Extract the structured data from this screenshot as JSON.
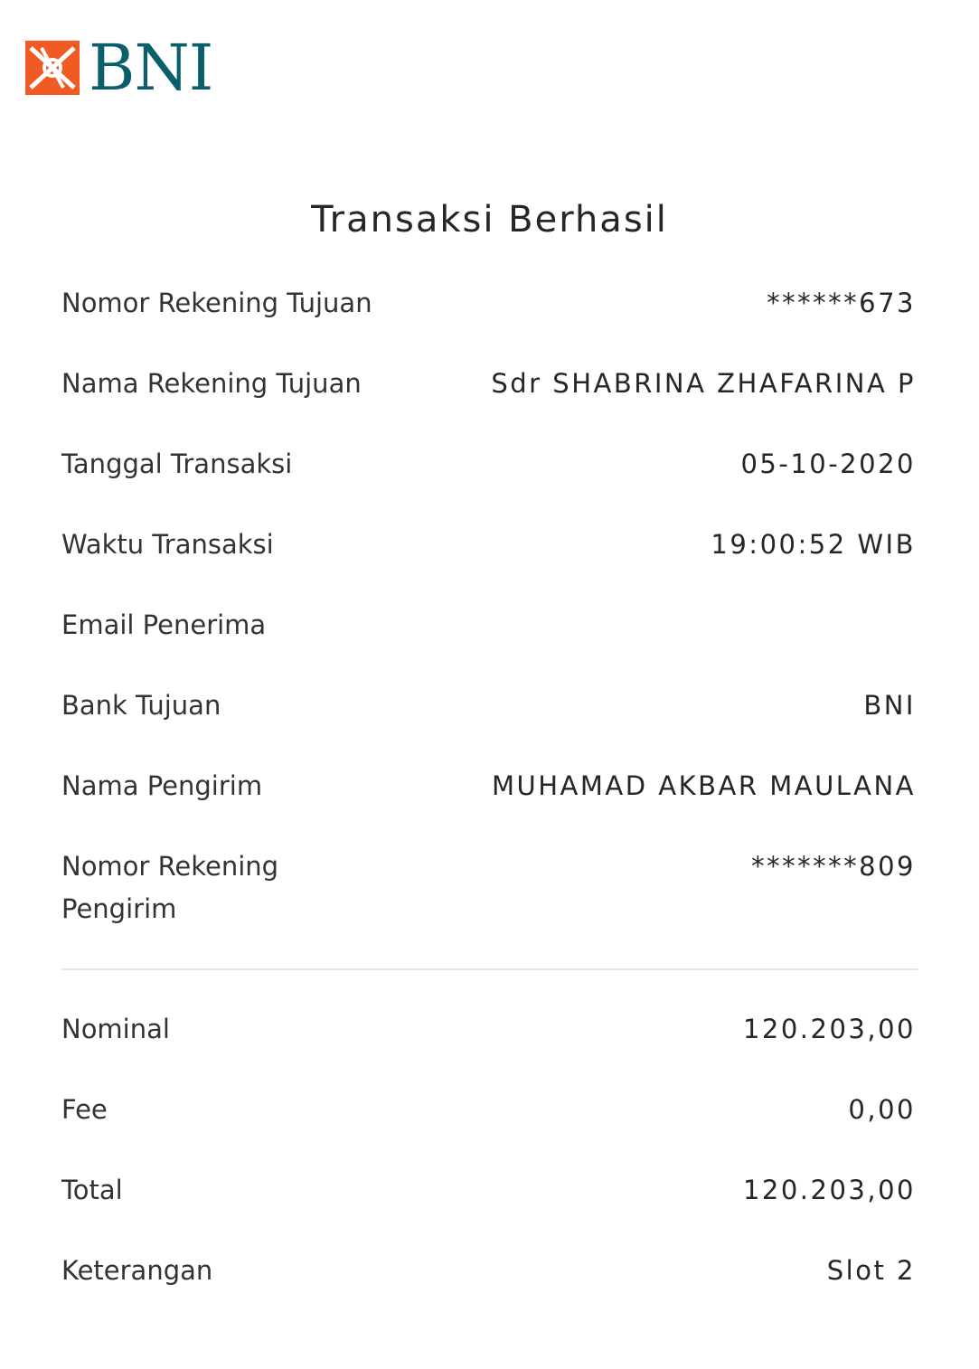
{
  "logo": {
    "brand_text": "BNI",
    "colors": {
      "mark": "#f15a23",
      "text": "#0b5f6b"
    }
  },
  "title": "Transaksi Berhasil",
  "details": [
    {
      "label": "Nomor Rekening Tujuan",
      "value": "******673"
    },
    {
      "label": "Nama Rekening Tujuan",
      "value": "Sdr SHABRINA ZHAFARINA P"
    },
    {
      "label": "Tanggal Transaksi",
      "value": "05-10-2020"
    },
    {
      "label": "Waktu Transaksi",
      "value": "19:00:52 WIB"
    },
    {
      "label": "Email Penerima",
      "value": ""
    },
    {
      "label": "Bank Tujuan",
      "value": "BNI"
    },
    {
      "label": "Nama Pengirim",
      "value": "MUHAMAD AKBAR MAULANA"
    },
    {
      "label": "Nomor Rekening Pengirim",
      "value": "*******809"
    }
  ],
  "amounts": [
    {
      "label": "Nominal",
      "value": "120.203,00"
    },
    {
      "label": "Fee",
      "value": "0,00"
    },
    {
      "label": "Total",
      "value": "120.203,00"
    },
    {
      "label": "Keterangan",
      "value": "Slot 2"
    }
  ]
}
